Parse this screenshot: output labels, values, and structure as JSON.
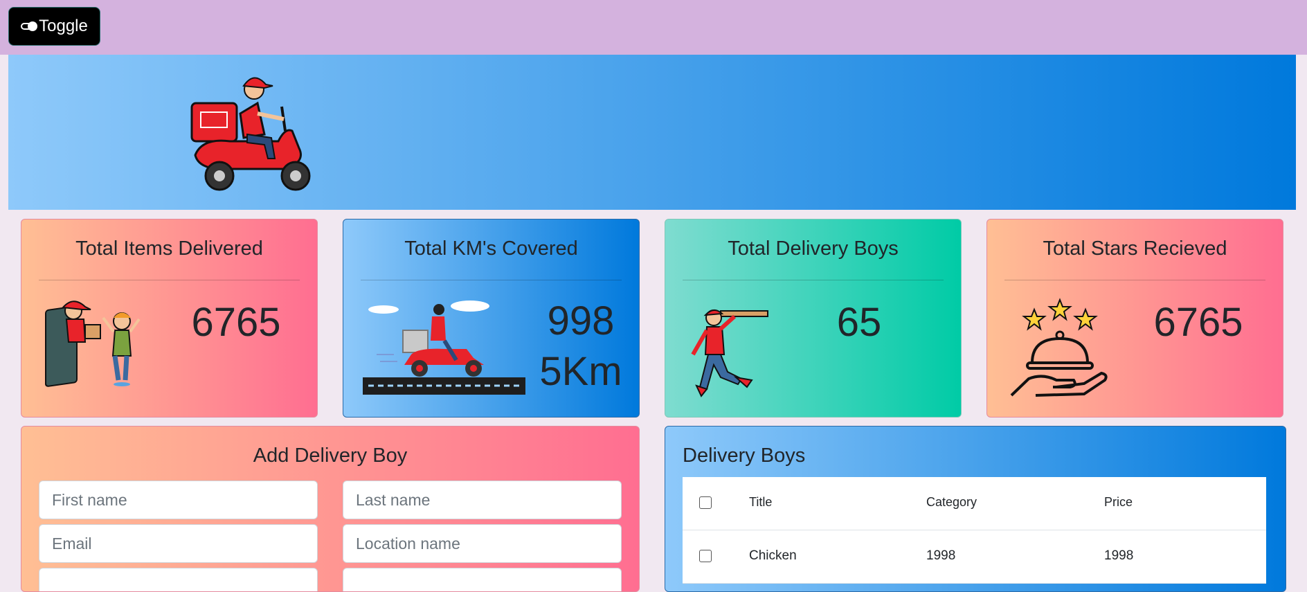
{
  "topbar": {
    "toggle_label": "Toggle"
  },
  "stats": [
    {
      "title": "Total Items Delivered",
      "value": "6765"
    },
    {
      "title": "Total KM's Covered",
      "value_line1": "998",
      "value_line2": "5Km"
    },
    {
      "title": "Total Delivery Boys",
      "value": "65"
    },
    {
      "title": "Total Stars Recieved",
      "value": "6765"
    }
  ],
  "form": {
    "title": "Add Delivery Boy",
    "first_name_placeholder": "First name",
    "last_name_placeholder": "Last name",
    "email_placeholder": "Email",
    "location_placeholder": "Location name"
  },
  "table": {
    "title": "Delivery Boys",
    "columns": [
      "Title",
      "Category",
      "Price"
    ],
    "rows": [
      {
        "title": "Chicken",
        "category": "1998",
        "price": "1998"
      }
    ]
  },
  "colors": {
    "topbar": "#d4b2de",
    "hero_gradient_start": "#8ec9fa",
    "hero_gradient_end": "#0079dc",
    "peach_start": "#ffbf94",
    "peach_end": "#ff6e91",
    "teal_start": "#7fdcd0",
    "teal_end": "#00cba6"
  },
  "icons": [
    "toggle-icon",
    "delivery-scooter-illustration",
    "parcel-delivery-illustration",
    "road-scooter-illustration",
    "running-pizza-boy-illustration",
    "stars-cloche-illustration"
  ]
}
